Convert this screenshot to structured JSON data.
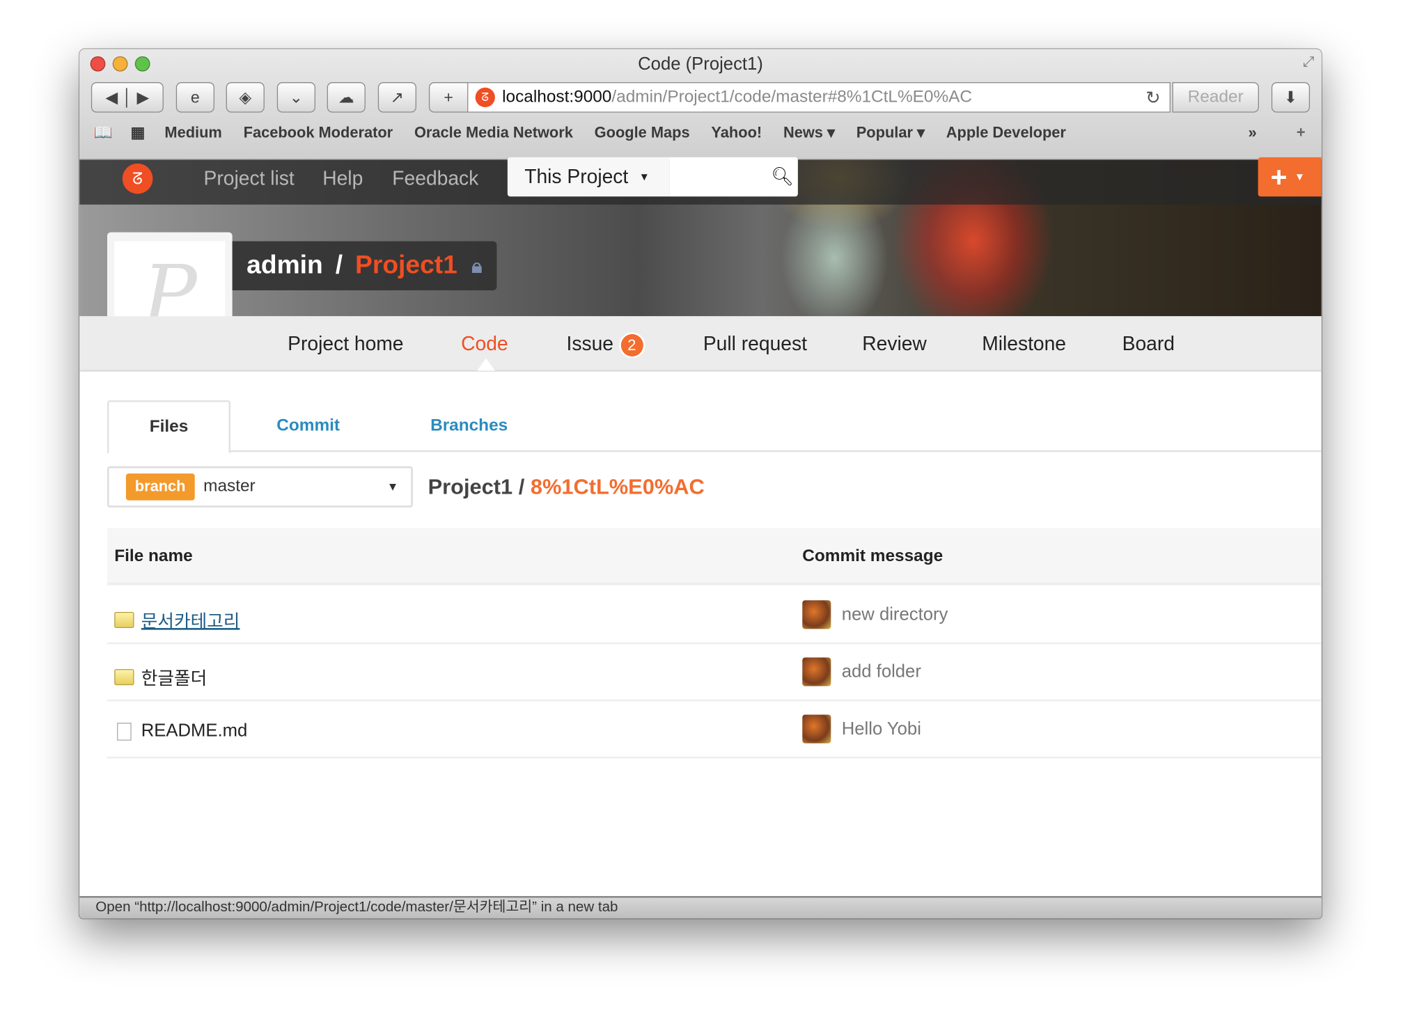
{
  "window": {
    "title": "Code (Project1)"
  },
  "toolbar": {
    "url_host": "localhost:9000",
    "url_path": "/admin/Project1/code/master#8%1CtL%E0%AC",
    "reader": "Reader"
  },
  "bookmarks": [
    "Medium",
    "Facebook Moderator",
    "Oracle Media Network",
    "Google Maps",
    "Yahoo!",
    "News ▾",
    "Popular ▾",
    "Apple Developer"
  ],
  "gnav": {
    "items": [
      "Project list",
      "Help",
      "Feedback"
    ],
    "scope": "This Project",
    "search_placeholder": ""
  },
  "project": {
    "owner": "admin",
    "separator": "/",
    "name": "Project1"
  },
  "pnav": {
    "items": [
      {
        "label": "Project home"
      },
      {
        "label": "Code",
        "active": true
      },
      {
        "label": "Issue",
        "badge": "2"
      },
      {
        "label": "Pull request"
      },
      {
        "label": "Review"
      },
      {
        "label": "Milestone"
      },
      {
        "label": "Board"
      }
    ]
  },
  "tabs": [
    "Files",
    "Commit",
    "Branches"
  ],
  "branch": {
    "tag": "branch",
    "value": "master"
  },
  "crumb": {
    "project": "Project1 /",
    "path": "8%1CtL%E0%AC"
  },
  "table": {
    "headers": [
      "File name",
      "Commit message"
    ],
    "rows": [
      {
        "name": "문서카테고리",
        "type": "folder",
        "message": "new directory"
      },
      {
        "name": "한글폴더",
        "type": "folder",
        "message": "add folder"
      },
      {
        "name": "README.md",
        "type": "file",
        "message": "Hello Yobi"
      }
    ]
  },
  "status": "Open “http://localhost:9000/admin/Project1/code/master/문서카테고리” in a new tab",
  "colors": {
    "accent": "#f04e23",
    "link": "#2a8bbf",
    "branch": "#f39a2b"
  }
}
